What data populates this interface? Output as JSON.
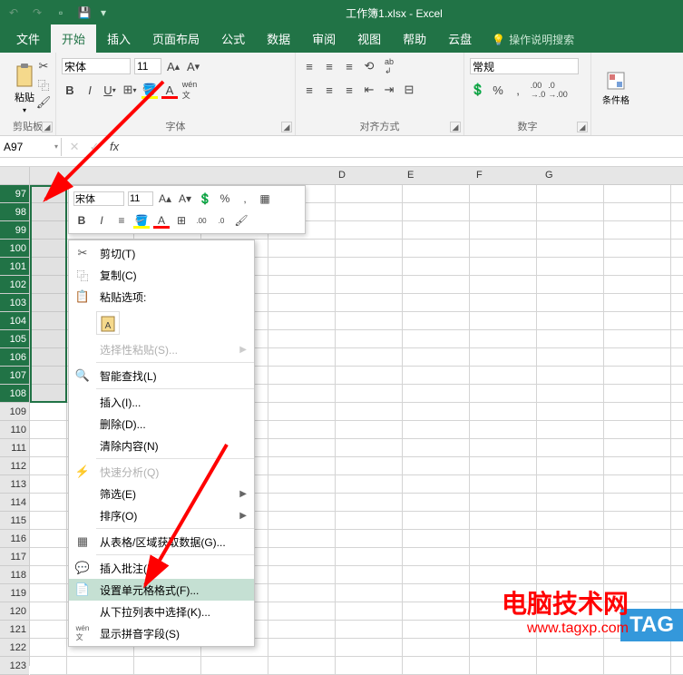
{
  "titlebar": {
    "title": "工作簿1.xlsx - Excel"
  },
  "tabs": {
    "file": "文件",
    "home": "开始",
    "insert": "插入",
    "pageLayout": "页面布局",
    "formulas": "公式",
    "data": "数据",
    "review": "审阅",
    "view": "视图",
    "help": "帮助",
    "yunpan": "云盘",
    "tellme": "操作说明搜索"
  },
  "ribbon": {
    "clipboard_label": "剪贴板",
    "paste_label": "粘贴",
    "font_label": "字体",
    "font_name": "宋体",
    "font_size": "11",
    "alignment_label": "对齐方式",
    "number_label": "数字",
    "number_format": "常规",
    "cond_fmt": "条件格"
  },
  "formula_bar": {
    "name_box": "A97"
  },
  "mini_toolbar": {
    "font": "宋体",
    "size": "11"
  },
  "context_menu": {
    "cut": "剪切(T)",
    "copy": "复制(C)",
    "paste_options": "粘贴选项:",
    "paste_special": "选择性粘贴(S)...",
    "smart_lookup": "智能查找(L)",
    "insert": "插入(I)...",
    "delete": "删除(D)...",
    "clear": "清除内容(N)",
    "quick_analysis": "快速分析(Q)",
    "filter": "筛选(E)",
    "sort": "排序(O)",
    "get_data": "从表格/区域获取数据(G)...",
    "insert_comment": "插入批注(M)",
    "format_cells": "设置单元格格式(F)...",
    "pick_from_list": "从下拉列表中选择(K)...",
    "show_pinyin": "显示拼音字段(S)"
  },
  "rows": [
    "97",
    "98",
    "99",
    "100",
    "101",
    "102",
    "103",
    "104",
    "105",
    "106",
    "107",
    "108",
    "109",
    "110",
    "111",
    "112",
    "113",
    "114",
    "115",
    "116",
    "117",
    "118",
    "119",
    "120",
    "121",
    "122",
    "123"
  ],
  "cols": {
    "D": "D",
    "E": "E",
    "F": "F",
    "G": "G"
  },
  "watermark": {
    "line1": "电脑技术网",
    "line2": "www.tagxp.com",
    "tag": "TAG"
  },
  "chart_data": null
}
